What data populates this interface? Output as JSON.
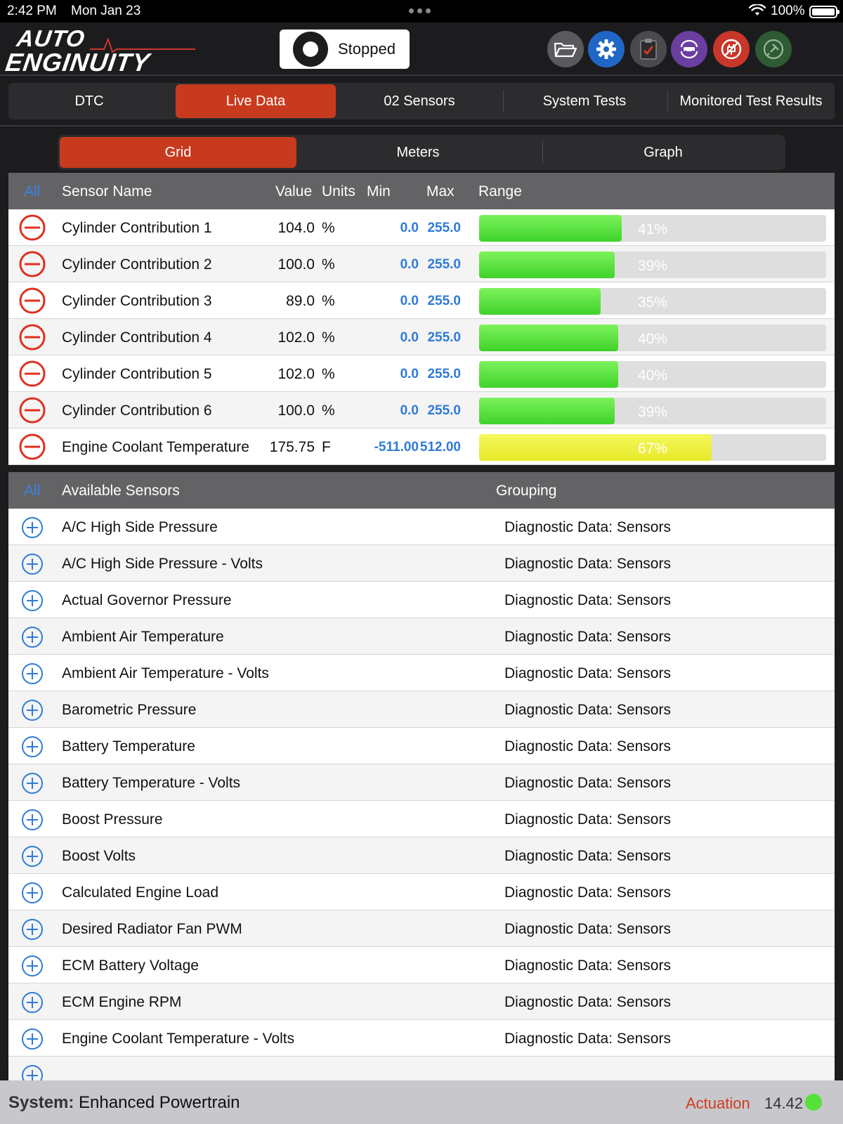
{
  "status_bar": {
    "time": "2:42 PM",
    "date": "Mon Jan 23",
    "battery": "100%"
  },
  "header": {
    "logo_line1": "AUTO",
    "logo_line2": "ENGINUITY",
    "record_label": "Stopped",
    "tools": [
      "folder-icon",
      "gear-icon",
      "clipboard-icon",
      "reset-icon",
      "disconnect-icon",
      "connect-icon"
    ],
    "tool_colors": [
      "#5a5a5e",
      "#1f66c6",
      "#4a4a4e",
      "#6a3fa0",
      "#c8372a",
      "#2e5a34"
    ]
  },
  "tabs": [
    "DTC",
    "Live Data",
    "02 Sensors",
    "System Tests",
    "Monitored Test Results"
  ],
  "active_tab": "Live Data",
  "views": [
    "Grid",
    "Meters",
    "Graph"
  ],
  "active_view": "Grid",
  "live_table": {
    "headers": {
      "all": "All",
      "sensor_name": "Sensor Name",
      "value": "Value",
      "units": "Units",
      "min": "Min",
      "max": "Max",
      "range": "Range"
    },
    "rows": [
      {
        "name": "Cylinder Contribution 1",
        "value": "104.0",
        "units": "%",
        "min": "0.0",
        "max": "255.0",
        "pct": "41%",
        "fraction": 0.41,
        "color": "green"
      },
      {
        "name": "Cylinder Contribution 2",
        "value": "100.0",
        "units": "%",
        "min": "0.0",
        "max": "255.0",
        "pct": "39%",
        "fraction": 0.39,
        "color": "green"
      },
      {
        "name": "Cylinder Contribution 3",
        "value": "89.0",
        "units": "%",
        "min": "0.0",
        "max": "255.0",
        "pct": "35%",
        "fraction": 0.35,
        "color": "green"
      },
      {
        "name": "Cylinder Contribution 4",
        "value": "102.0",
        "units": "%",
        "min": "0.0",
        "max": "255.0",
        "pct": "40%",
        "fraction": 0.4,
        "color": "green"
      },
      {
        "name": "Cylinder Contribution 5",
        "value": "102.0",
        "units": "%",
        "min": "0.0",
        "max": "255.0",
        "pct": "40%",
        "fraction": 0.4,
        "color": "green"
      },
      {
        "name": "Cylinder Contribution 6",
        "value": "100.0",
        "units": "%",
        "min": "0.0",
        "max": "255.0",
        "pct": "39%",
        "fraction": 0.39,
        "color": "green"
      },
      {
        "name": "Engine Coolant Temperature",
        "value": "175.75",
        "units": "F",
        "min": "-511.00",
        "max": "512.00",
        "pct": "67%",
        "fraction": 0.67,
        "color": "yellow"
      }
    ]
  },
  "available": {
    "headers": {
      "all": "All",
      "name": "Available Sensors",
      "grouping": "Grouping"
    },
    "rows": [
      {
        "name": "A/C High Side Pressure",
        "group": "Diagnostic Data: Sensors"
      },
      {
        "name": "A/C High Side Pressure - Volts",
        "group": "Diagnostic Data: Sensors"
      },
      {
        "name": "Actual Governor Pressure",
        "group": "Diagnostic Data: Sensors"
      },
      {
        "name": "Ambient Air Temperature",
        "group": "Diagnostic Data: Sensors"
      },
      {
        "name": "Ambient Air Temperature - Volts",
        "group": "Diagnostic Data: Sensors"
      },
      {
        "name": "Barometric Pressure",
        "group": "Diagnostic Data: Sensors"
      },
      {
        "name": "Battery Temperature",
        "group": "Diagnostic Data: Sensors"
      },
      {
        "name": "Battery Temperature - Volts",
        "group": "Diagnostic Data: Sensors"
      },
      {
        "name": "Boost Pressure",
        "group": "Diagnostic Data: Sensors"
      },
      {
        "name": "Boost Volts",
        "group": "Diagnostic Data: Sensors"
      },
      {
        "name": "Calculated Engine Load",
        "group": "Diagnostic Data: Sensors"
      },
      {
        "name": "Desired Radiator Fan PWM",
        "group": "Diagnostic Data: Sensors"
      },
      {
        "name": "ECM Battery Voltage",
        "group": "Diagnostic Data: Sensors"
      },
      {
        "name": "ECM Engine RPM",
        "group": "Diagnostic Data: Sensors"
      },
      {
        "name": "Engine Coolant Temperature - Volts",
        "group": "Diagnostic Data: Sensors"
      }
    ]
  },
  "footer": {
    "system_label": "System:",
    "system_value": "Enhanced Powertrain",
    "actuation": "Actuation",
    "voltage": "14.42"
  }
}
